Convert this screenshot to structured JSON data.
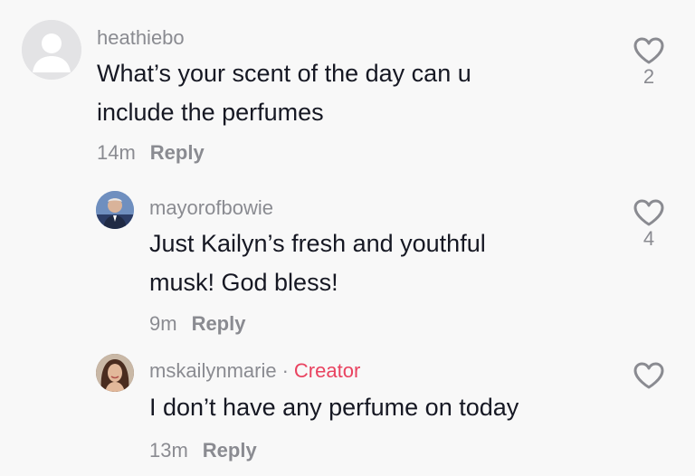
{
  "comments": [
    {
      "username": "heathiebo",
      "text_lines": [
        "What’s your scent of the day can u",
        "include the perfumes"
      ],
      "time": "14m",
      "reply_label": "Reply",
      "like_count": "2",
      "avatar": "default-avatar-icon"
    },
    {
      "username": "mayorofbowie",
      "text_lines": [
        "Just Kailyn’s fresh and youthful",
        "musk! God bless!"
      ],
      "time": "9m",
      "reply_label": "Reply",
      "like_count": "4",
      "avatar": "user-photo"
    },
    {
      "username": "mskailynmarie",
      "separator": "·",
      "badge": "Creator",
      "text_lines": [
        "I don’t have any perfume on today"
      ],
      "time": "13m",
      "reply_label": "Reply",
      "like_count": "",
      "avatar": "user-photo"
    }
  ],
  "colors": {
    "background": "#f8f8f8",
    "text": "#161823",
    "muted": "#8a8b91",
    "creator_badge": "#e94360"
  }
}
